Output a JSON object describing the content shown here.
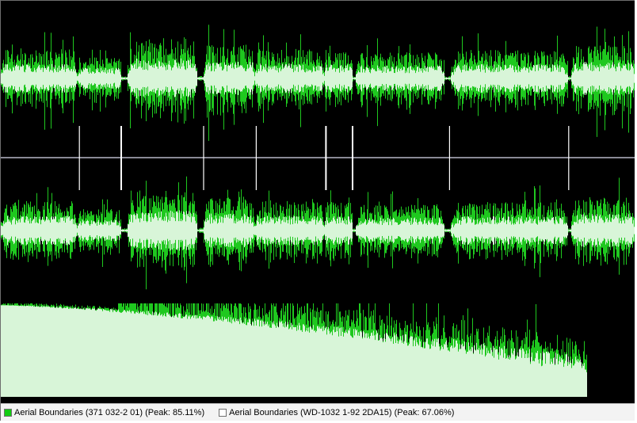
{
  "colors": {
    "background": "#000000",
    "track_a": "#1fc81f",
    "track_b": "#d8f5d8",
    "divider": "#8a8a96",
    "marker": "#ffffff"
  },
  "legend": [
    {
      "label": "Aerial Boundaries (371 032-2 01) (Peak: 85.11%)",
      "color": "#11cc11"
    },
    {
      "label": "Aerial Boundaries (WD-1032 1-92 2DA15) (Peak: 67.06%)",
      "color": "#ffffff"
    }
  ],
  "segments": [
    {
      "start": 0.0,
      "end": 0.12,
      "level": 0.62
    },
    {
      "start": 0.12,
      "end": 0.19,
      "level": 0.45
    },
    {
      "start": 0.2,
      "end": 0.31,
      "level": 0.85
    },
    {
      "start": 0.32,
      "end": 0.4,
      "level": 0.72
    },
    {
      "start": 0.4,
      "end": 0.51,
      "level": 0.62
    },
    {
      "start": 0.51,
      "end": 0.555,
      "level": 0.6
    },
    {
      "start": 0.56,
      "end": 0.7,
      "level": 0.55
    },
    {
      "start": 0.71,
      "end": 0.895,
      "level": 0.6
    },
    {
      "start": 0.9,
      "end": 1.0,
      "level": 0.7
    }
  ],
  "markers": [
    0.124,
    0.19,
    0.32,
    0.403,
    0.513,
    0.555,
    0.708,
    0.896
  ]
}
